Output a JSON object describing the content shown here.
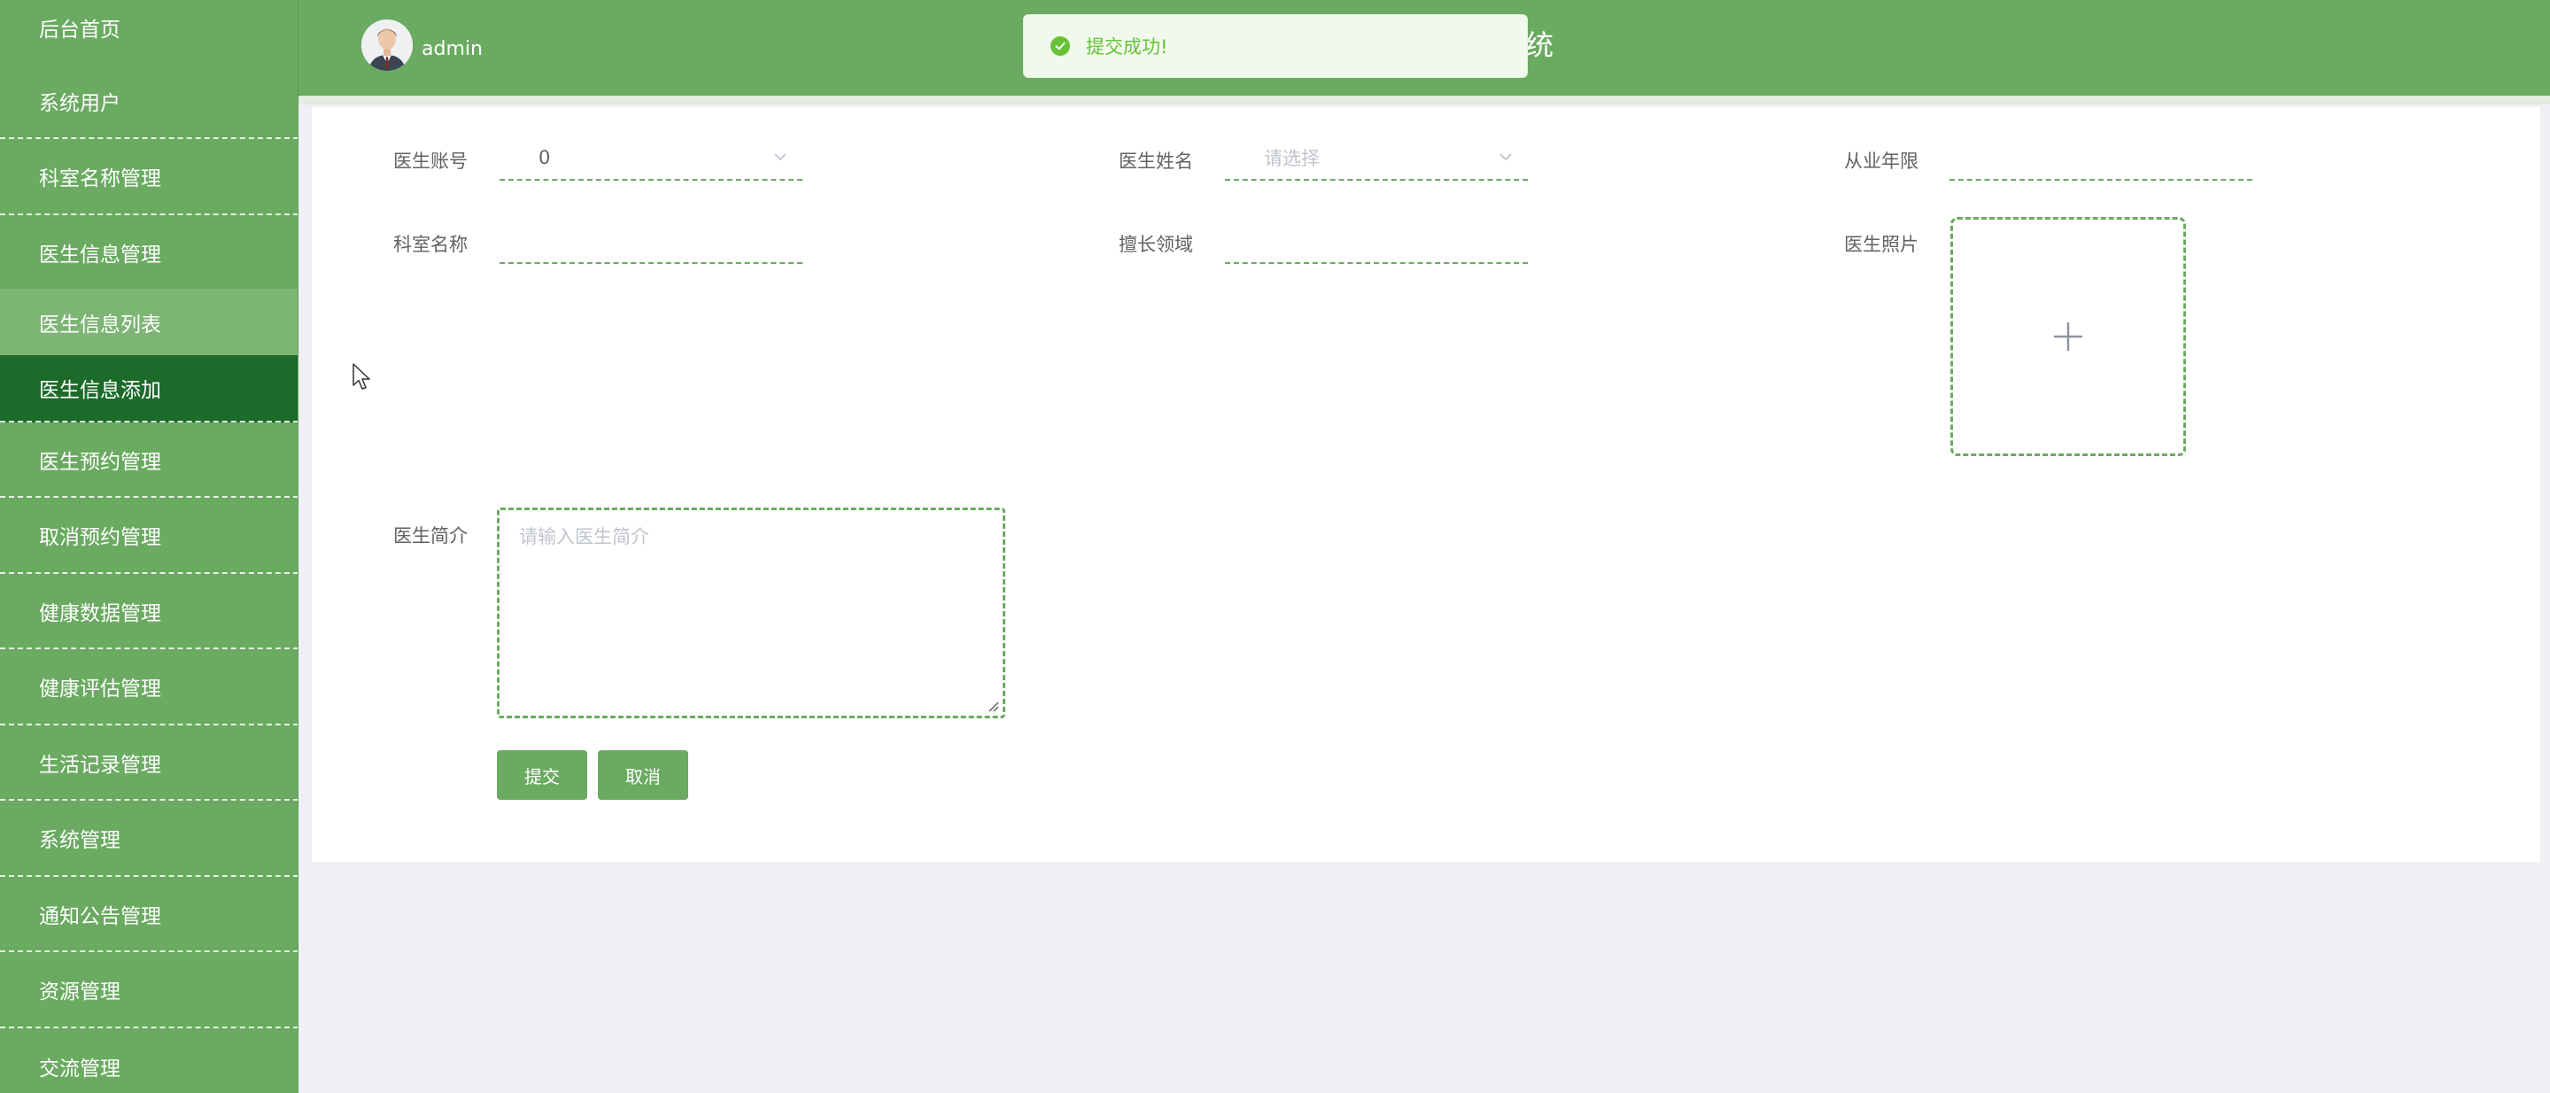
{
  "sidebar": {
    "items": [
      {
        "label": "后台首页"
      },
      {
        "label": "系统用户"
      },
      {
        "label": "科室名称管理"
      },
      {
        "label": "医生信息管理"
      },
      {
        "label": "医生信息列表"
      },
      {
        "label": "医生信息添加"
      },
      {
        "label": "医生预约管理"
      },
      {
        "label": "取消预约管理"
      },
      {
        "label": "健康数据管理"
      },
      {
        "label": "健康评估管理"
      },
      {
        "label": "生活记录管理"
      },
      {
        "label": "系统管理"
      },
      {
        "label": "通知公告管理"
      },
      {
        "label": "资源管理"
      },
      {
        "label": "交流管理"
      }
    ]
  },
  "header": {
    "username": "admin",
    "title_fragment": "统",
    "toast": "提交成功!"
  },
  "form": {
    "doctor_account": {
      "label": "医生账号",
      "value": "0"
    },
    "doctor_name": {
      "label": "医生姓名",
      "placeholder": "请选择"
    },
    "years": {
      "label": "从业年限",
      "value": ""
    },
    "department": {
      "label": "科室名称",
      "value": ""
    },
    "specialty": {
      "label": "擅长领域",
      "value": ""
    },
    "photo": {
      "label": "医生照片"
    },
    "intro": {
      "label": "医生简介",
      "placeholder": "请输入医生简介"
    },
    "submit_label": "提交",
    "cancel_label": "取消"
  },
  "icons": {
    "toast": "check-circle-icon",
    "upload": "plus-icon",
    "select": "chevron-down-icon"
  },
  "colors": {
    "primary": "#6aaa61",
    "active": "#1c6b2a",
    "success": "#67c23a"
  }
}
